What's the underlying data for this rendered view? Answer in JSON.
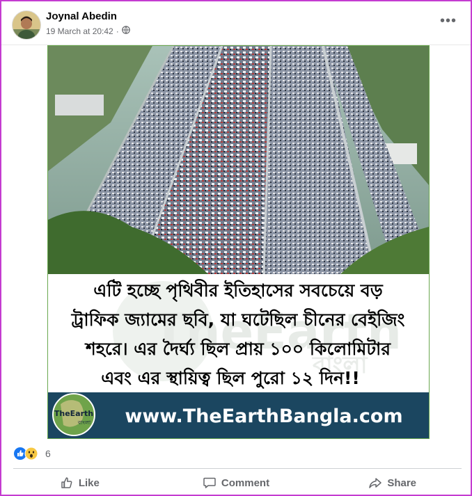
{
  "post": {
    "author": "Joynal Abedin",
    "timestamp": "19 March at 20:42",
    "separator": "·",
    "privacy_icon": "globe-icon",
    "more_icon": "more-options-icon",
    "more_label": "•••"
  },
  "image": {
    "caption_lines": [
      "এটি হচ্ছে পৃথিবীর ইতিহাসের সবচেয়ে বড়",
      "ট্রাফিক জ্যামের ছবি, যা ঘটেছিল চীনের বেইজিং",
      "শহরে। এর দৈর্ঘ্য ছিল প্রায় ১০০ কিলোমিটার",
      "এবং এর স্থায়িত্ব ছিল পুরো ১২ দিন!!"
    ],
    "watermark": "TheEarth",
    "watermark_sub": "বাংলা",
    "logo_text": "TheEarth",
    "logo_sub": "বাংলা",
    "banner_url": "www.TheEarthBangla.com",
    "colors": {
      "banner": "#1b4660",
      "border": "#6aa84f",
      "sky": "#8fb0a5"
    }
  },
  "reactions": {
    "types": [
      "like-icon",
      "wow-icon"
    ],
    "count": "6"
  },
  "actions": {
    "like": "Like",
    "comment": "Comment",
    "share": "Share"
  }
}
